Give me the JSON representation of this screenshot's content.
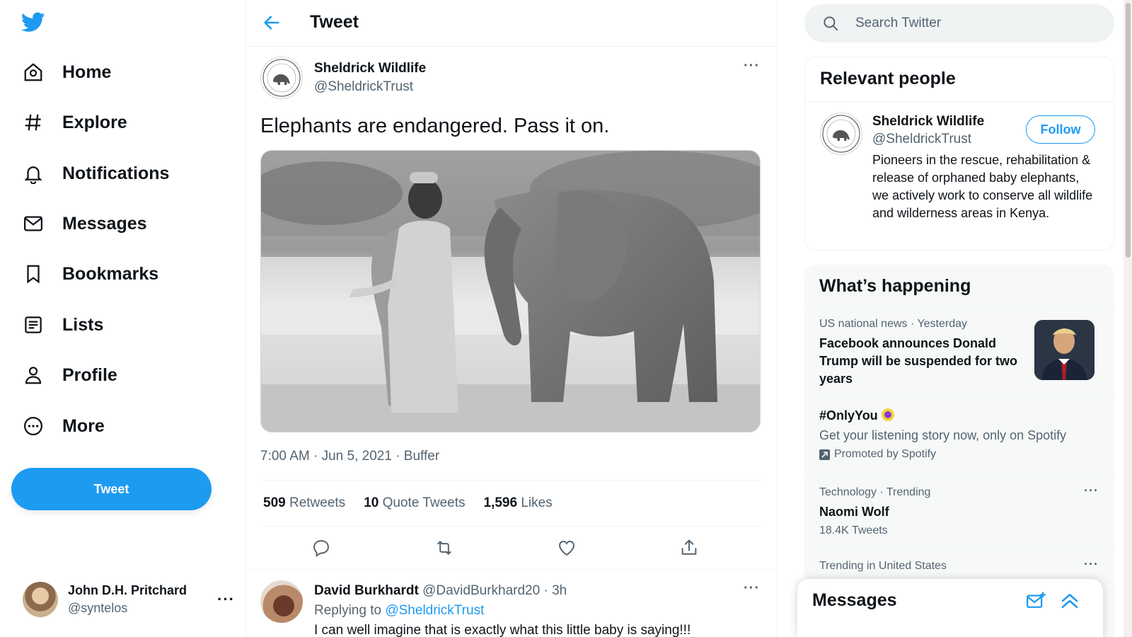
{
  "nav": {
    "items": [
      {
        "label": "Home",
        "icon": "home-icon"
      },
      {
        "label": "Explore",
        "icon": "hashtag-icon"
      },
      {
        "label": "Notifications",
        "icon": "bell-icon"
      },
      {
        "label": "Messages",
        "icon": "envelope-icon"
      },
      {
        "label": "Bookmarks",
        "icon": "bookmark-icon"
      },
      {
        "label": "Lists",
        "icon": "list-icon"
      },
      {
        "label": "Profile",
        "icon": "person-icon"
      },
      {
        "label": "More",
        "icon": "more-circle-icon"
      }
    ],
    "tweet_button": "Tweet",
    "account": {
      "name": "John D.H. Pritchard",
      "handle": "@syntelos",
      "more": "···"
    }
  },
  "header": {
    "title": "Tweet"
  },
  "tweet": {
    "author_name": "Sheldrick Wildlife",
    "author_handle": "@SheldrickTrust",
    "text": "Elephants are endangered. Pass it on.",
    "meta": "7:00 AM · Jun 5, 2021 · Buffer",
    "retweets": "509",
    "retweets_label": "Retweets",
    "quotes": "10",
    "quotes_label": "Quote Tweets",
    "likes": "1,596",
    "likes_label": "Likes",
    "more": "···"
  },
  "reply": {
    "name": "David Burkhardt",
    "handle": "@DavidBurkhard20",
    "time": "· 3h",
    "replying_prefix": "Replying to",
    "replying_to": "@SheldrickTrust",
    "text": "I can well imagine that is exactly what this little baby is saying!!!",
    "more": "···"
  },
  "search": {
    "placeholder": "Search Twitter"
  },
  "relevant": {
    "heading": "Relevant people",
    "name": "Sheldrick Wildlife",
    "handle": "@SheldrickTrust",
    "follow": "Follow",
    "bio": "Pioneers in the rescue, rehabilitation & release of orphaned baby elephants, we actively work to conserve all wildlife and wilderness areas in Kenya."
  },
  "trends": {
    "heading": "What’s happening",
    "items": [
      {
        "meta": "US national news · Yesterday",
        "title": "Facebook announces Donald Trump will be suspended for two years"
      },
      {
        "title": "#OnlyYou",
        "sub": "Get your listening story now, only on Spotify",
        "promoted": "Promoted by Spotify"
      },
      {
        "meta": "Technology · Trending",
        "title": "Naomi Wolf",
        "sub": "18.4K Tweets"
      },
      {
        "meta": "Trending in United States"
      }
    ]
  },
  "messages_drawer": {
    "title": "Messages"
  },
  "colors": {
    "accent": "#1d9bf0",
    "text": "#0f1419",
    "muted": "#536471"
  }
}
